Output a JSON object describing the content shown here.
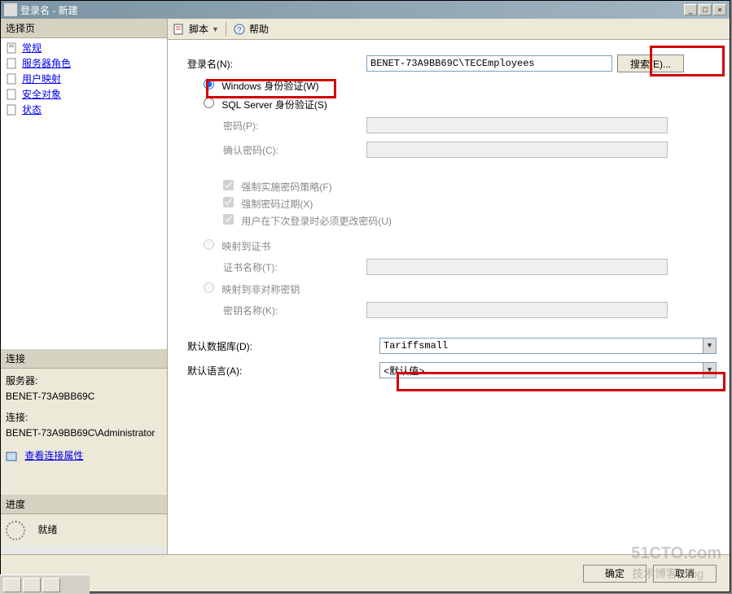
{
  "window": {
    "title": "登录名 - 新建"
  },
  "sidebar": {
    "select_header": "选择页",
    "items": [
      {
        "label": "常规"
      },
      {
        "label": "服务器角色"
      },
      {
        "label": "用户映射"
      },
      {
        "label": "安全对象"
      },
      {
        "label": "状态"
      }
    ],
    "conn_header": "连接",
    "server_label": "服务器:",
    "server_value": "BENET-73A9BB69C",
    "conn_label": "连接:",
    "conn_value": "BENET-73A9BB69C\\Administrator",
    "view_conn": "查看连接属性",
    "progress_header": "进度",
    "ready": "就绪"
  },
  "toolbar": {
    "script": "脚本",
    "help": "帮助"
  },
  "form": {
    "login_name_label": "登录名(N):",
    "login_name_value": "BENET-73A9BB69C\\TECEmployees",
    "search_btn": "搜索(E)...",
    "radio_windows": "Windows 身份验证(W)",
    "radio_sql": "SQL Server 身份验证(S)",
    "password_label": "密码(P):",
    "confirm_password_label": "确认密码(C):",
    "enforce_policy": "强制实施密码策略(F)",
    "enforce_expiry": "强制密码过期(X)",
    "must_change": "用户在下次登录时必须更改密码(U)",
    "radio_cert": "映射到证书",
    "cert_name_label": "证书名称(T):",
    "radio_asymkey": "映射到非对称密钥",
    "key_name_label": "密钥名称(K):",
    "default_db_label": "默认数据库(D):",
    "default_db_value": "Tariffsmall",
    "default_lang_label": "默认语言(A):",
    "default_lang_value": "<默认值>"
  },
  "footer": {
    "ok": "确定",
    "cancel": "取消"
  },
  "watermark": {
    "line1": "51CTO.com",
    "line2": "技术博客  Blog"
  }
}
